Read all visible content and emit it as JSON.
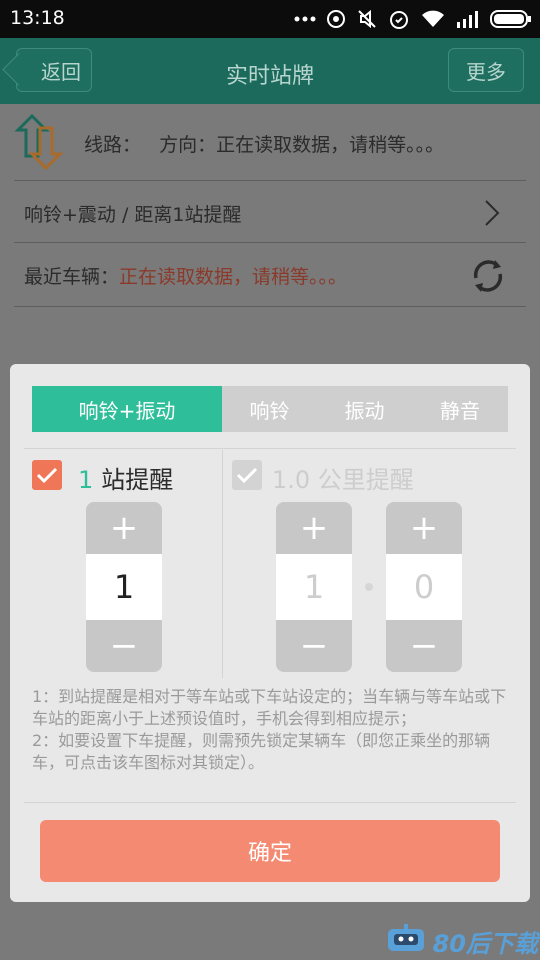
{
  "status_bar": {
    "time": "13:18",
    "icons": [
      "more-dots-icon",
      "sync-icon",
      "mute-icon",
      "alarm-icon",
      "wifi-icon",
      "signal-icon",
      "battery-icon"
    ]
  },
  "header": {
    "back_label": "返回",
    "title": "实时站牌",
    "more_label": "更多"
  },
  "route": {
    "label": "线路：",
    "direction": "方向：正在读取数据，请稍等。。。"
  },
  "reminder": {
    "text": "响铃+震动 / 距离1站提醒"
  },
  "vehicle": {
    "label": "最近车辆：",
    "value": "正在读取数据，请稍等。。。"
  },
  "dialog": {
    "modes": [
      {
        "label": "响铃+振动",
        "active": true
      },
      {
        "label": "响铃",
        "active": false
      },
      {
        "label": "振动",
        "active": false
      },
      {
        "label": "静音",
        "active": false
      }
    ],
    "station_remind": {
      "checked": true,
      "count": "1",
      "label": "站提醒",
      "stepper_value": "1",
      "plus": "+",
      "minus": "−"
    },
    "distance_remind": {
      "checked": false,
      "label": "1.0 公里提醒",
      "integer_value": "1",
      "decimal_value": "0",
      "plus": "+",
      "minus": "−"
    },
    "notes": [
      "1：到站提醒是相对于等车站或下车站设定的；当车辆与等车站或下车站的距离小于上述预设值时，手机会得到相应提示；",
      "2：如要设置下车提醒，则需预先锁定某辆车（即您正乘坐的那辆车，可点击该车图标对其锁定）。"
    ],
    "confirm_label": "确定"
  },
  "watermark": {
    "text": "80后下载"
  },
  "colors": {
    "header_bg": "#1c6a5b",
    "accent_green": "#2fbe9a",
    "checkbox_orange": "#ef7758",
    "confirm_bg": "#f58a72",
    "vehicle_status_red": "#8a3a2a"
  }
}
